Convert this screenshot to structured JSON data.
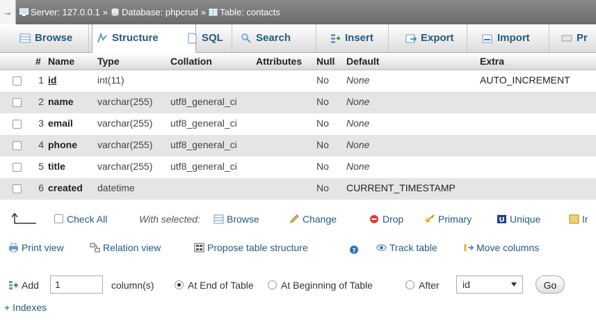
{
  "breadcrumb": {
    "server": "Server: 127.0.0.1",
    "database": "Database: phpcrud",
    "table": "Table: contacts",
    "separator": "»",
    "arrow": "→"
  },
  "tabs": [
    {
      "label": "Browse",
      "icon": "browse-icon"
    },
    {
      "label": "Structure",
      "icon": "structure-icon",
      "active": true
    },
    {
      "label": "SQL",
      "icon": "sql-icon"
    },
    {
      "label": "Search",
      "icon": "search-icon"
    },
    {
      "label": "Insert",
      "icon": "insert-icon"
    },
    {
      "label": "Export",
      "icon": "export-icon"
    },
    {
      "label": "Import",
      "icon": "import-icon"
    },
    {
      "label": "Pr",
      "icon": "privileges-icon"
    }
  ],
  "columns": {
    "num": "#",
    "name": "Name",
    "type": "Type",
    "collation": "Collation",
    "attributes": "Attributes",
    "null": "Null",
    "default": "Default",
    "extra": "Extra"
  },
  "rows": [
    {
      "num": "1",
      "name": "id",
      "type": "int(11)",
      "collation": "",
      "null": "No",
      "default": "None",
      "extra": "AUTO_INCREMENT"
    },
    {
      "num": "2",
      "name": "name",
      "type": "varchar(255)",
      "collation": "utf8_general_ci",
      "null": "No",
      "default": "None",
      "extra": ""
    },
    {
      "num": "3",
      "name": "email",
      "type": "varchar(255)",
      "collation": "utf8_general_ci",
      "null": "No",
      "default": "None",
      "extra": ""
    },
    {
      "num": "4",
      "name": "phone",
      "type": "varchar(255)",
      "collation": "utf8_general_ci",
      "null": "No",
      "default": "None",
      "extra": ""
    },
    {
      "num": "5",
      "name": "title",
      "type": "varchar(255)",
      "collation": "utf8_general_ci",
      "null": "No",
      "default": "None",
      "extra": ""
    },
    {
      "num": "6",
      "name": "created",
      "type": "datetime",
      "collation": "",
      "null": "No",
      "default": "CURRENT_TIMESTAMP",
      "extra": ""
    }
  ],
  "selection": {
    "check_all": "Check All",
    "with_selected": "With selected:",
    "browse": "Browse",
    "change": "Change",
    "drop": "Drop",
    "primary": "Primary",
    "unique": "Unique",
    "index": "Ir"
  },
  "actions": {
    "print_view": "Print view",
    "relation_view": "Relation view",
    "propose": "Propose table structure",
    "track": "Track table",
    "move": "Move columns"
  },
  "add": {
    "label": "Add",
    "count": "1",
    "columns_label": "column(s)",
    "at_end": "At End of Table",
    "at_beginning": "At Beginning of Table",
    "after": "After",
    "after_field": "id",
    "go": "Go"
  },
  "indexes": "+ Indexes",
  "colors": {
    "link": "#235a81",
    "header_bar": "#7a7a7a",
    "stripe": "#e5e5e5"
  }
}
